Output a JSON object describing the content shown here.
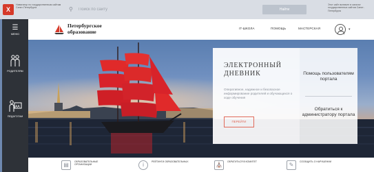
{
  "topbar": {
    "gov_badge": "Х",
    "gov_text": "Навигатор по государственным сайтам Санкт-Петербурга",
    "search_placeholder": "Поиск по сайту",
    "find_label": "Найти",
    "right_text": "Этот сайт включен в каталог государственных сайтов Санкт-Петербурга"
  },
  "sidebar": {
    "menu_label": "МЕНЮ",
    "items": [
      {
        "label": "РОДИТЕЛЯМ",
        "icon": "parents-icon"
      },
      {
        "label": "ПЕДАГОГАМ",
        "icon": "teachers-icon"
      }
    ]
  },
  "header": {
    "logo_line1": "Петербургское",
    "logo_line2": "образование",
    "nav": [
      "IT-ШКОЛА",
      "ПОМОЩЬ",
      "МАСТЕРСКАЯ"
    ],
    "caret": "▾"
  },
  "hero": {
    "diary_title_1": "ЭЛЕКТРОННЫЙ",
    "diary_title_2": "ДНЕВНИК",
    "diary_desc": "Оперативное, надежное и безопасное информирование родителей и обучающихся о ходе обучения",
    "go_label": "ПЕРЕЙТИ",
    "help_1": "Помощь пользователям портала",
    "help_2": "Обратиться к администратору портала"
  },
  "bottom": [
    {
      "icon": "document-icon",
      "text": "ОБРАЗОВАТЕЛЬНЫЕ ОРГАНИЗАЦИИ"
    },
    {
      "icon": "info-icon",
      "text": "РЕЙТИНГИ ОБРАЗОВАТЕЛЬНЫХ"
    },
    {
      "icon": "institution-icon",
      "text": "ОБРАТИТЬСЯ В КОМИТЕТ"
    },
    {
      "icon": "report-icon",
      "text": "СООБЩИТЬ О НАРУШЕНИИ"
    }
  ],
  "colors": {
    "accent": "#e06a5a",
    "sidebar": "#2e3238",
    "page_bg": "#6f89b0"
  }
}
